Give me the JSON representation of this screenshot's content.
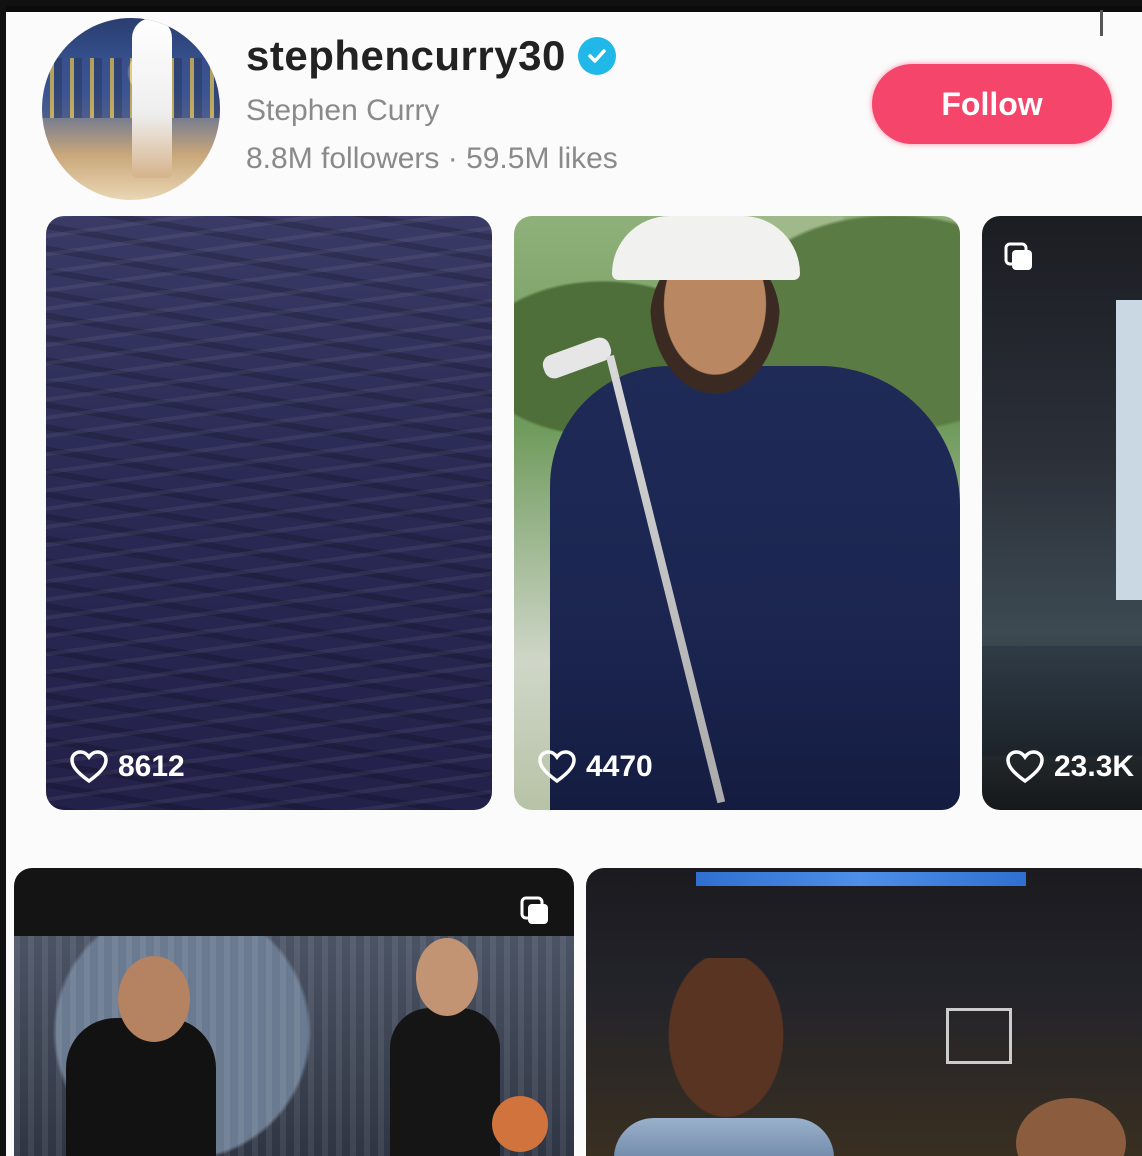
{
  "profile": {
    "username": "stephencurry30",
    "display_name": "Stephen Curry",
    "stats": "8.8M followers · 59.5M likes",
    "verified": true,
    "follow_label": "Follow"
  },
  "colors": {
    "follow_button": "#f5456a",
    "verified_badge": "#20b8e8"
  },
  "posts": [
    {
      "likes": "8612",
      "multi_image": false
    },
    {
      "likes": "4470",
      "multi_image": false
    },
    {
      "likes": "23.3K",
      "multi_image": true
    },
    {
      "likes": "",
      "multi_image": true
    },
    {
      "likes": "",
      "multi_image": false
    }
  ]
}
